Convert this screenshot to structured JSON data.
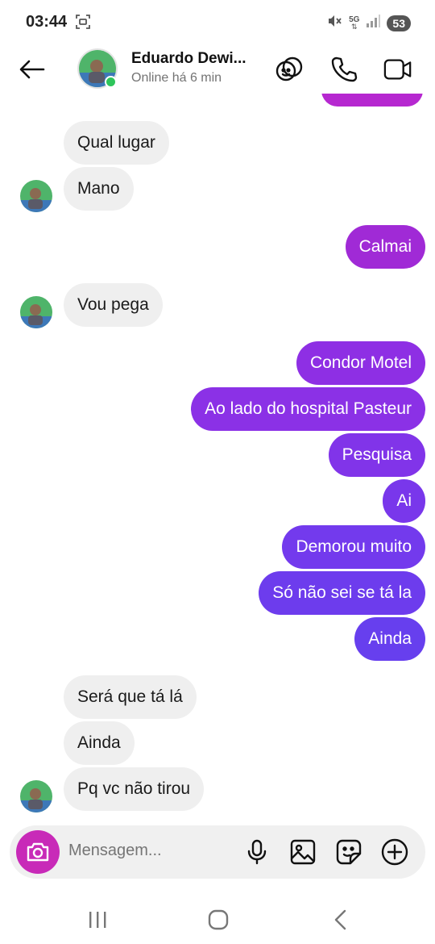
{
  "status_bar": {
    "time": "03:44",
    "network": "5G",
    "battery": "53",
    "icons": [
      "screenshot-icon",
      "mute-icon",
      "network-icon",
      "signal-icon",
      "battery-icon"
    ]
  },
  "header": {
    "contact_name": "Eduardo Dewi...",
    "contact_status": "Online há 6 min",
    "icons": [
      "back-arrow-icon",
      "sticker-icon",
      "phone-icon",
      "video-icon"
    ]
  },
  "messages": [
    {
      "side": "in",
      "text": "Qual lugar"
    },
    {
      "side": "in",
      "text": "Mano"
    },
    {
      "side": "out",
      "text": "Calmai",
      "color": "#a02ad6"
    },
    {
      "side": "in",
      "text": "Vou pega"
    },
    {
      "side": "out",
      "text": "Condor Motel",
      "color": "#8e2fe4"
    },
    {
      "side": "out",
      "text": "Ao lado do hospital Pasteur",
      "color": "#8b31e6"
    },
    {
      "side": "out",
      "text": "Pesquisa",
      "color": "#8134e9"
    },
    {
      "side": "out",
      "text": "Ai",
      "color": "#7937eb"
    },
    {
      "side": "out",
      "text": "Demorou muito",
      "color": "#733aed"
    },
    {
      "side": "out",
      "text": "Só não sei se tá la",
      "color": "#6d3ced"
    },
    {
      "side": "out",
      "text": "Ainda",
      "color": "#673fee"
    },
    {
      "side": "in",
      "text": "Será que tá lá"
    },
    {
      "side": "in",
      "text": "Ainda"
    },
    {
      "side": "in",
      "text": "Pq vc não tirou"
    }
  ],
  "composer": {
    "placeholder": "Mensagem...",
    "icons": [
      "camera-icon",
      "microphone-icon",
      "gallery-icon",
      "sticker-icon",
      "plus-icon"
    ]
  },
  "colors": {
    "accent_top": "#b628d0",
    "accent_bottom": "#673fee",
    "incoming_bubble": "#efefef",
    "camera_button": "#c82ab8",
    "online": "#2ec55b"
  }
}
